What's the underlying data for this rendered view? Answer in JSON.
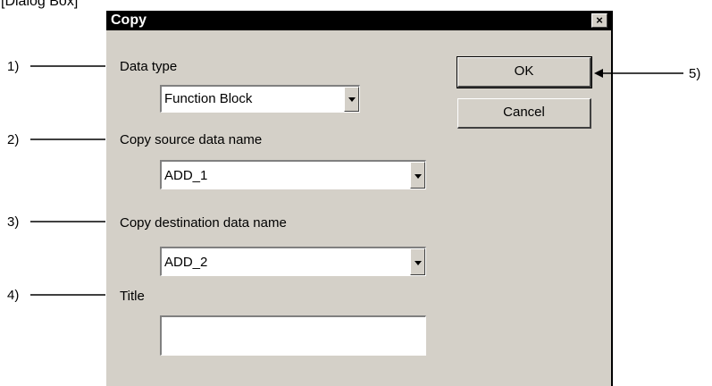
{
  "caption": "[Dialog Box]",
  "dialog": {
    "title": "Copy",
    "close_glyph": "×",
    "data_type": {
      "label": "Data type",
      "value": "Function Block"
    },
    "copy_source": {
      "label": "Copy source data name",
      "value": "ADD_1"
    },
    "copy_destination": {
      "label": "Copy destination data name",
      "value": "ADD_2"
    },
    "title_field": {
      "label": "Title",
      "value": ""
    },
    "ok_label": "OK",
    "cancel_label": "Cancel"
  },
  "callouts": [
    "1)",
    "2)",
    "3)",
    "4)",
    "5)"
  ],
  "icons": {
    "close": "close-icon",
    "dropdown": "chevron-down-icon",
    "pointer": "arrow-icon"
  },
  "colors": {
    "dialog_bg": "#d4d0c8",
    "titlebar_bg": "#000000",
    "titlebar_text": "#ffffff"
  }
}
